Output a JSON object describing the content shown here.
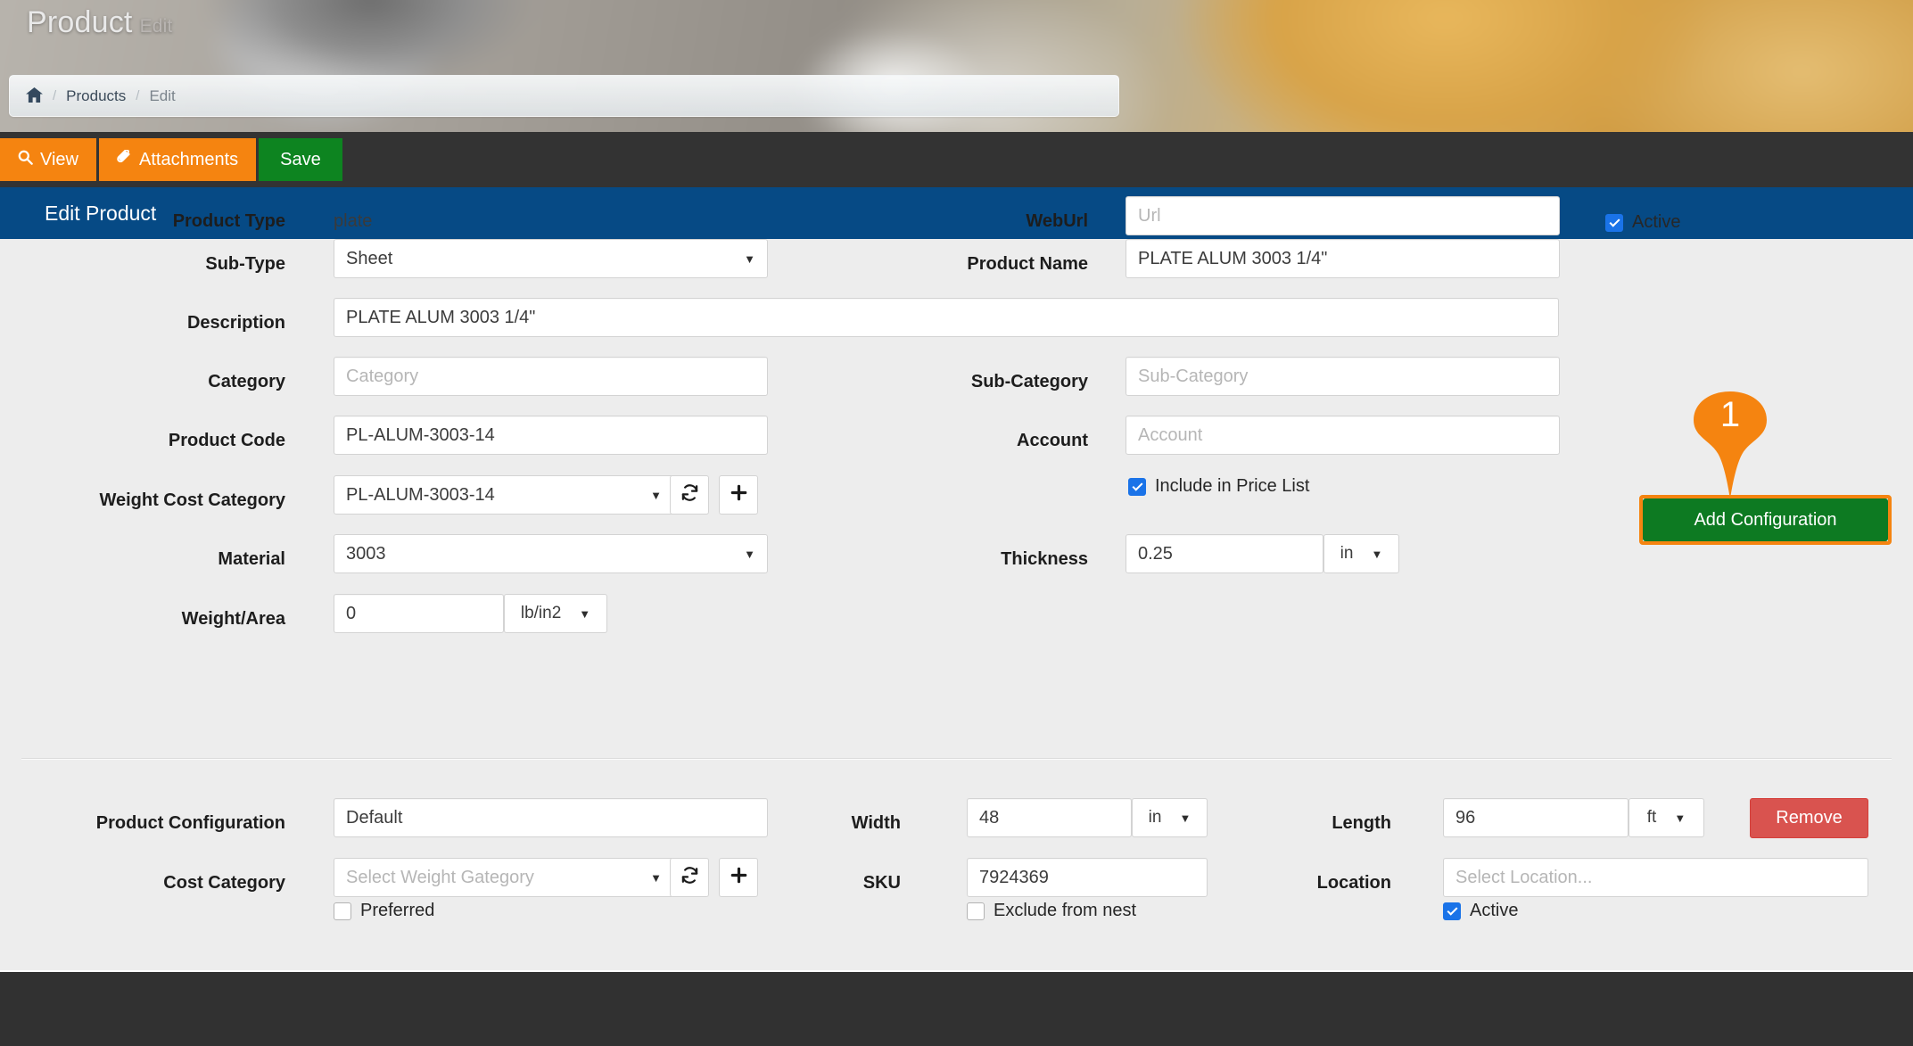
{
  "banner": {
    "title": "Product",
    "subtitle": "Edit"
  },
  "breadcrumb": {
    "home_icon": "home-icon",
    "separator": "/",
    "items": [
      "Products",
      "Edit"
    ]
  },
  "toolbar": {
    "view_label": "View",
    "view_icon": "search-icon",
    "attachments_label": "Attachments",
    "attachments_icon": "paperclip-icon",
    "save_label": "Save"
  },
  "section": {
    "title": "Edit Product"
  },
  "form": {
    "product_type": {
      "label": "Product Type",
      "value": "plate"
    },
    "sub_type": {
      "label": "Sub-Type",
      "value": "Sheet"
    },
    "description": {
      "label": "Description",
      "value": "PLATE ALUM 3003 1/4\""
    },
    "category": {
      "label": "Category",
      "placeholder": "Category",
      "value": ""
    },
    "product_code": {
      "label": "Product Code",
      "value": "PL-ALUM-3003-14"
    },
    "weight_cost_category": {
      "label": "Weight Cost Category",
      "value": "PL-ALUM-3003-14",
      "refresh_icon": "refresh-icon",
      "add_icon": "plus-icon"
    },
    "material": {
      "label": "Material",
      "value": "3003"
    },
    "weight_area": {
      "label": "Weight/Area",
      "value": "0",
      "unit": "lb/in2"
    },
    "web_url": {
      "label": "WebUrl",
      "placeholder": "Url",
      "value": ""
    },
    "product_name": {
      "label": "Product Name",
      "value": "PLATE ALUM 3003 1/4\""
    },
    "sub_category": {
      "label": "Sub-Category",
      "placeholder": "Sub-Category",
      "value": ""
    },
    "account": {
      "label": "Account",
      "placeholder": "Account",
      "value": ""
    },
    "include_price_list": {
      "label": "Include in Price List",
      "checked": true
    },
    "thickness": {
      "label": "Thickness",
      "value": "0.25",
      "unit": "in"
    },
    "active_top": {
      "label": "Active",
      "checked": true
    },
    "add_configuration": {
      "label": "Add Configuration"
    }
  },
  "callout": {
    "number": "1"
  },
  "configuration": {
    "product_configuration": {
      "label": "Product Configuration",
      "value": "Default"
    },
    "cost_category": {
      "label": "Cost Category",
      "placeholder": "Select Weight Gategory",
      "value": "",
      "refresh_icon": "refresh-icon",
      "add_icon": "plus-icon"
    },
    "preferred": {
      "label": "Preferred",
      "checked": false
    },
    "width": {
      "label": "Width",
      "value": "48",
      "unit": "in"
    },
    "sku": {
      "label": "SKU",
      "value": "7924369"
    },
    "exclude_from_nest": {
      "label": "Exclude from nest",
      "checked": false
    },
    "length": {
      "label": "Length",
      "value": "96",
      "unit": "ft"
    },
    "location": {
      "label": "Location",
      "placeholder": "Select Location...",
      "value": ""
    },
    "remove": {
      "label": "Remove"
    },
    "active": {
      "label": "Active",
      "checked": true
    }
  },
  "colors": {
    "accent_blue": "#064a85",
    "orange": "#f58410",
    "green": "#0d7a22",
    "red": "#d9534f",
    "dark": "#333333",
    "checkbox_blue": "#1a73e8"
  }
}
